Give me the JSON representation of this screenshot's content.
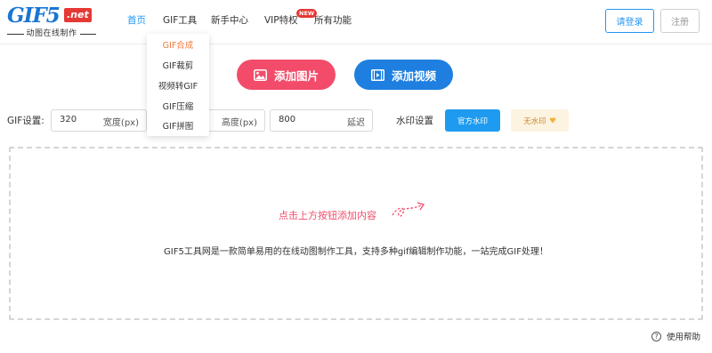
{
  "header": {
    "logo_text": "GIF5",
    "logo_badge": ".net",
    "logo_slogan": "动图在线制作",
    "nav": [
      {
        "label": "首页",
        "active": true
      },
      {
        "label": "GIF工具",
        "active": false
      },
      {
        "label": "新手中心",
        "active": false
      },
      {
        "label": "VIP特权",
        "active": false
      },
      {
        "label": "所有功能",
        "active": false
      }
    ],
    "new_badge": "NEW",
    "login_label": "请登录",
    "register_label": "注册"
  },
  "dropdown": {
    "items": [
      "GIF合成",
      "GIF裁剪",
      "视频转GIF",
      "GIF压缩",
      "GIF拼图"
    ],
    "active_index": 0
  },
  "actions": {
    "add_image_label": "添加图片",
    "add_video_label": "添加视频"
  },
  "settings": {
    "label": "GIF设置:",
    "width_value": "320",
    "width_unit": "宽度(px)",
    "height_unit": "高度(px)",
    "delay_value": "800",
    "delay_unit": "延迟",
    "watermark_label": "水印设置",
    "official_watermark": "官方水印",
    "no_watermark": "无水印"
  },
  "dropzone": {
    "hint": "点击上方按钮添加内容",
    "description": "GIF5工具网是一款简单易用的在线动图制作工具，支持多种gif编辑制作功能，一站完成GIF处理！"
  },
  "help_label": "使用帮助",
  "colors": {
    "primary": "#2196f3",
    "image_button": "#f24c6a",
    "video_button": "#1e7fe0",
    "dropdown_active": "#f2793a",
    "new_badge": "#e53935",
    "no_watermark_bg": "#fdf3e1",
    "no_watermark_text": "#c9892a"
  }
}
